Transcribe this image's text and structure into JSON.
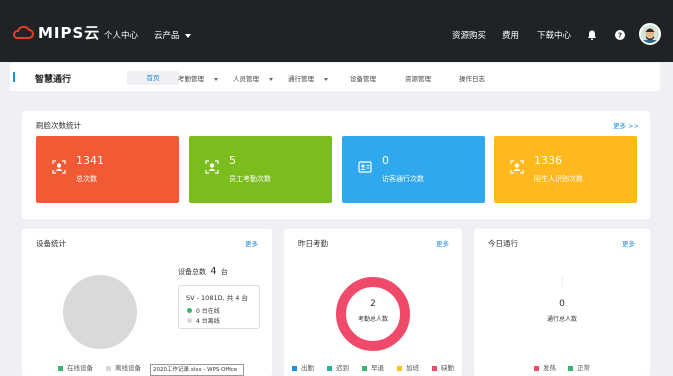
{
  "topbar": {
    "logo_text": "MIPS云",
    "nav_personal": "个人中心",
    "nav_products": "云产品",
    "nav_resource": "资源购买",
    "nav_fee": "费用",
    "nav_download": "下载中心",
    "bg": "#1f2326"
  },
  "subbar": {
    "title": "智慧通行",
    "tabs": [
      "首页",
      "考勤管理",
      "人员管理",
      "通行管理",
      "设备管理",
      "资源管理",
      "操作日志"
    ]
  },
  "face_stats": {
    "title": "刷脸次数统计",
    "more": "更多 >>",
    "items": [
      {
        "value": "1341",
        "label": "总次数",
        "color": "#f05a35",
        "icon": "user-face-icon"
      },
      {
        "value": "5",
        "label": "员工考勤次数",
        "color": "#7cbd1e",
        "icon": "employee-icon"
      },
      {
        "value": "0",
        "label": "访客通行次数",
        "color": "#2fa8ee",
        "icon": "visitor-icon"
      },
      {
        "value": "1336",
        "label": "陌生人识别次数",
        "color": "#ffb81e",
        "icon": "stranger-icon"
      }
    ]
  },
  "device": {
    "title": "设备统计",
    "more": "更多",
    "total_label": "设备总数",
    "total_value": "4",
    "total_unit": "台",
    "model_line": "SV - 1081D, 共 4 台",
    "online": "0 台在线",
    "offline": "4 台离线",
    "legend_online": "在线设备",
    "legend_offline": "离线设备",
    "online_color": "#3cb371",
    "offline_color": "#d9d9d9"
  },
  "attendance": {
    "title": "昨日考勤",
    "more": "更多",
    "center_value": "2",
    "center_label": "考勤总人数",
    "ring_color": "#ef4a6a",
    "legend": [
      {
        "label": "出勤",
        "color": "#1e8fe1"
      },
      {
        "label": "迟到",
        "color": "#24b3a4"
      },
      {
        "label": "早退",
        "color": "#3cb371"
      },
      {
        "label": "加班",
        "color": "#f5c518"
      },
      {
        "label": "缺勤",
        "color": "#ef4a6a"
      }
    ]
  },
  "traffic": {
    "title": "今日通行",
    "more": "更多",
    "center_value": "0",
    "center_label": "通行总人数",
    "legend": [
      {
        "label": "发热",
        "color": "#ef4a6a"
      },
      {
        "label": "正常",
        "color": "#3cb371"
      }
    ]
  },
  "taskbar_item": "2020工作记录.xlsx - WPS Office"
}
